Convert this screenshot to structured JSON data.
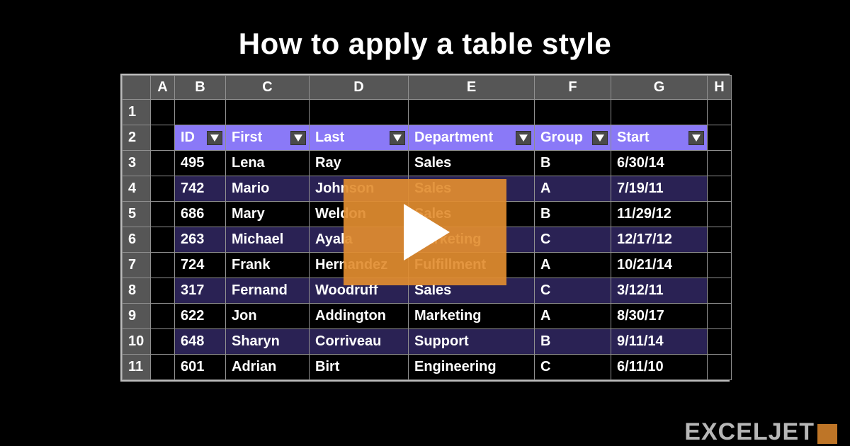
{
  "title": "How to apply a table style",
  "brand": "EXCELJET",
  "sheet": {
    "columns": [
      "A",
      "B",
      "C",
      "D",
      "E",
      "F",
      "G",
      "H"
    ],
    "row_numbers": [
      "1",
      "2",
      "3",
      "4",
      "5",
      "6",
      "7",
      "8",
      "9",
      "10",
      "11"
    ],
    "headers": [
      "ID",
      "First",
      "Last",
      "Department",
      "Group",
      "Start"
    ],
    "rows": [
      {
        "id": "495",
        "first": "Lena",
        "last": "Ray",
        "dept": "Sales",
        "group": "B",
        "start": "6/30/14"
      },
      {
        "id": "742",
        "first": "Mario",
        "last": "Johnson",
        "dept": "Sales",
        "group": "A",
        "start": "7/19/11"
      },
      {
        "id": "686",
        "first": "Mary",
        "last": "Weldon",
        "dept": "Sales",
        "group": "B",
        "start": "11/29/12"
      },
      {
        "id": "263",
        "first": "Michael",
        "last": "Ayala",
        "dept": "Marketing",
        "group": "C",
        "start": "12/17/12"
      },
      {
        "id": "724",
        "first": "Frank",
        "last": "Hernandez",
        "dept": "Fulfillment",
        "group": "A",
        "start": "10/21/14"
      },
      {
        "id": "317",
        "first": "Fernand",
        "last": "Woodruff",
        "dept": "Sales",
        "group": "C",
        "start": "3/12/11"
      },
      {
        "id": "622",
        "first": "Jon",
        "last": "Addington",
        "dept": "Marketing",
        "group": "A",
        "start": "8/30/17"
      },
      {
        "id": "648",
        "first": "Sharyn",
        "last": "Corriveau",
        "dept": "Support",
        "group": "B",
        "start": "9/11/14"
      },
      {
        "id": "601",
        "first": "Adrian",
        "last": "Birt",
        "dept": "Engineering",
        "group": "C",
        "start": "6/11/10"
      }
    ]
  }
}
